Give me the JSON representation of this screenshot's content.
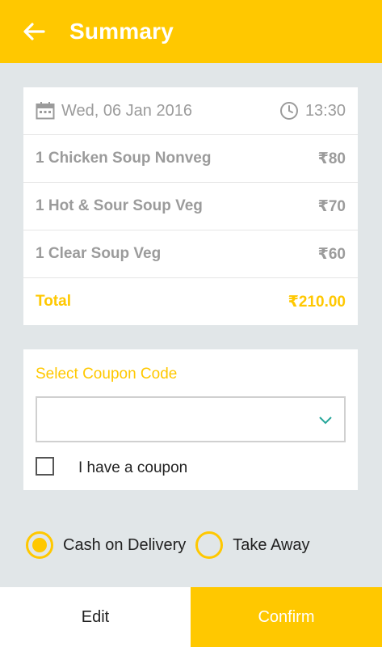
{
  "header": {
    "title": "Summary",
    "back_icon": "arrow-left-icon",
    "background_color": "#ffc800"
  },
  "order": {
    "date": "Wed, 06 Jan 2016",
    "time": "13:30",
    "items": [
      {
        "label": "1 Chicken Soup Nonveg",
        "price": "₹80"
      },
      {
        "label": "1 Hot & Sour Soup Veg",
        "price": "₹70"
      },
      {
        "label": "1 Clear Soup Veg",
        "price": "₹60"
      }
    ],
    "total_label": "Total",
    "total_value": "₹210.00"
  },
  "coupon": {
    "title": "Select Coupon Code",
    "selected_value": "",
    "checkbox_label": "I have a coupon",
    "checkbox_checked": false
  },
  "payment": {
    "options": [
      {
        "label": "Cash on Delivery",
        "selected": true
      },
      {
        "label": "Take Away",
        "selected": false
      }
    ]
  },
  "actions": {
    "edit_label": "Edit",
    "confirm_label": "Confirm"
  },
  "colors": {
    "accent": "#ffc800",
    "background": "#e1e6e8",
    "muted_text": "#9b9b9b",
    "chevron": "#26a69a"
  }
}
